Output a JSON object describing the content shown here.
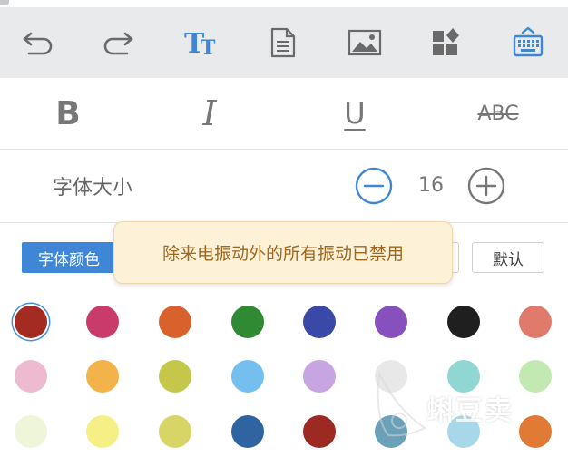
{
  "toolbar": {
    "items": [
      {
        "name": "undo-icon"
      },
      {
        "name": "redo-icon"
      },
      {
        "name": "text-style-icon",
        "label": "TT",
        "color": "#3f87d6"
      },
      {
        "name": "document-icon"
      },
      {
        "name": "image-icon"
      },
      {
        "name": "widgets-icon"
      },
      {
        "name": "keyboard-icon",
        "color": "#3f87d6"
      }
    ]
  },
  "format": {
    "bold": "B",
    "italic": "I",
    "underline": "U",
    "strikethrough": "ABC"
  },
  "font_size": {
    "label": "字体大小",
    "value": "16"
  },
  "color_tabs": {
    "font_color": "字体颜色",
    "default": "默认"
  },
  "toast": {
    "message": "除来电振动外的所有振动已禁用"
  },
  "swatches": {
    "row1": [
      "#a32b22",
      "#c93b6a",
      "#d9622c",
      "#2f8a33",
      "#3a48a8",
      "#8750bd",
      "#1f1f1f",
      "#e07b6c"
    ],
    "row2": [
      "#eebad0",
      "#f2b34a",
      "#c4c74a",
      "#74bff0",
      "#c7a4e2",
      "#e8e8e8",
      "#90d6d3",
      "#c2e9b2"
    ],
    "row3": [
      "#eef5d8",
      "#f6ef86",
      "#d6d566",
      "#2f64a0",
      "#9c2a22",
      "#6aa0b8",
      "#a6d8ea",
      "#e07a34"
    ]
  },
  "watermark": {
    "text": "蝌豆卖"
  }
}
